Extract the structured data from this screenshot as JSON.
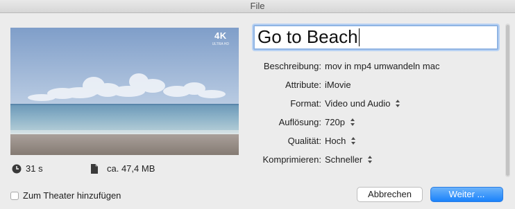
{
  "window": {
    "title": "File"
  },
  "preview": {
    "badge": "4K",
    "badge_sub": "ULTRA HD"
  },
  "info": {
    "duration": "31 s",
    "size": "ca. 47,4 MB"
  },
  "title_field": {
    "value": "Go to Beach"
  },
  "fields": [
    {
      "label": "Beschreibung:",
      "value": "mov in mp4 umwandeln mac",
      "stepper": false
    },
    {
      "label": "Attribute:",
      "value": "iMovie",
      "stepper": false
    },
    {
      "label": "Format:",
      "value": "Video und Audio",
      "stepper": true
    },
    {
      "label": "Auflösung:",
      "value": "720p",
      "stepper": true
    },
    {
      "label": "Qualität:",
      "value": "Hoch",
      "stepper": true
    },
    {
      "label": "Komprimieren:",
      "value": "Schneller",
      "stepper": true
    }
  ],
  "footer": {
    "checkbox_label": "Zum Theater hinzufügen",
    "checkbox_checked": false,
    "cancel_label": "Abbrechen",
    "continue_label": "Weiter ..."
  },
  "colors": {
    "accent": "#1a82fb",
    "focus_ring": "#8fb4e3"
  }
}
